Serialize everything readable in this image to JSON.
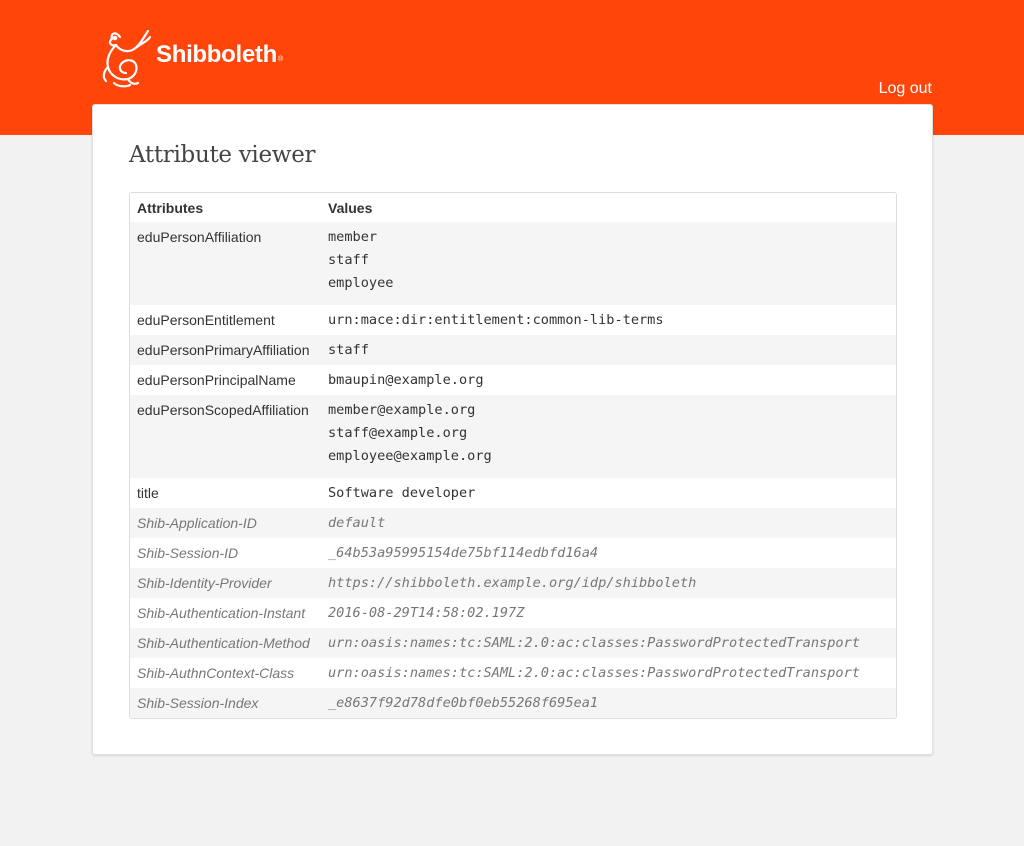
{
  "header": {
    "logo_text": "Shibboleth",
    "logo_trademark": "®",
    "logo_icon": "griffin-icon",
    "logout_label": "Log out",
    "brand_color": "#ff450a"
  },
  "main": {
    "title": "Attribute viewer",
    "table": {
      "columns": [
        "Attributes",
        "Values"
      ],
      "rows": [
        {
          "name": "eduPersonAffiliation",
          "values": [
            "member",
            "staff",
            "employee"
          ],
          "shib": false
        },
        {
          "name": "eduPersonEntitlement",
          "values": [
            "urn:mace:dir:entitlement:common-lib-terms"
          ],
          "shib": false
        },
        {
          "name": "eduPersonPrimaryAffiliation",
          "values": [
            "staff"
          ],
          "shib": false
        },
        {
          "name": "eduPersonPrincipalName",
          "values": [
            "bmaupin@example.org"
          ],
          "shib": false
        },
        {
          "name": "eduPersonScopedAffiliation",
          "values": [
            "member@example.org",
            "staff@example.org",
            "employee@example.org"
          ],
          "shib": false
        },
        {
          "name": "title",
          "values": [
            "Software developer"
          ],
          "shib": false
        },
        {
          "name": "Shib-Application-ID",
          "values": [
            "default"
          ],
          "shib": true
        },
        {
          "name": "Shib-Session-ID",
          "values": [
            "_64b53a95995154de75bf114edbfd16a4"
          ],
          "shib": true
        },
        {
          "name": "Shib-Identity-Provider",
          "values": [
            "https://shibboleth.example.org/idp/shibboleth"
          ],
          "shib": true
        },
        {
          "name": "Shib-Authentication-Instant",
          "values": [
            "2016-08-29T14:58:02.197Z"
          ],
          "shib": true
        },
        {
          "name": "Shib-Authentication-Method",
          "values": [
            "urn:oasis:names:tc:SAML:2.0:ac:classes:PasswordProtectedTransport"
          ],
          "shib": true
        },
        {
          "name": "Shib-AuthnContext-Class",
          "values": [
            "urn:oasis:names:tc:SAML:2.0:ac:classes:PasswordProtectedTransport"
          ],
          "shib": true
        },
        {
          "name": "Shib-Session-Index",
          "values": [
            "_e8637f92d78dfe0bf0eb55268f695ea1"
          ],
          "shib": true
        }
      ]
    }
  }
}
